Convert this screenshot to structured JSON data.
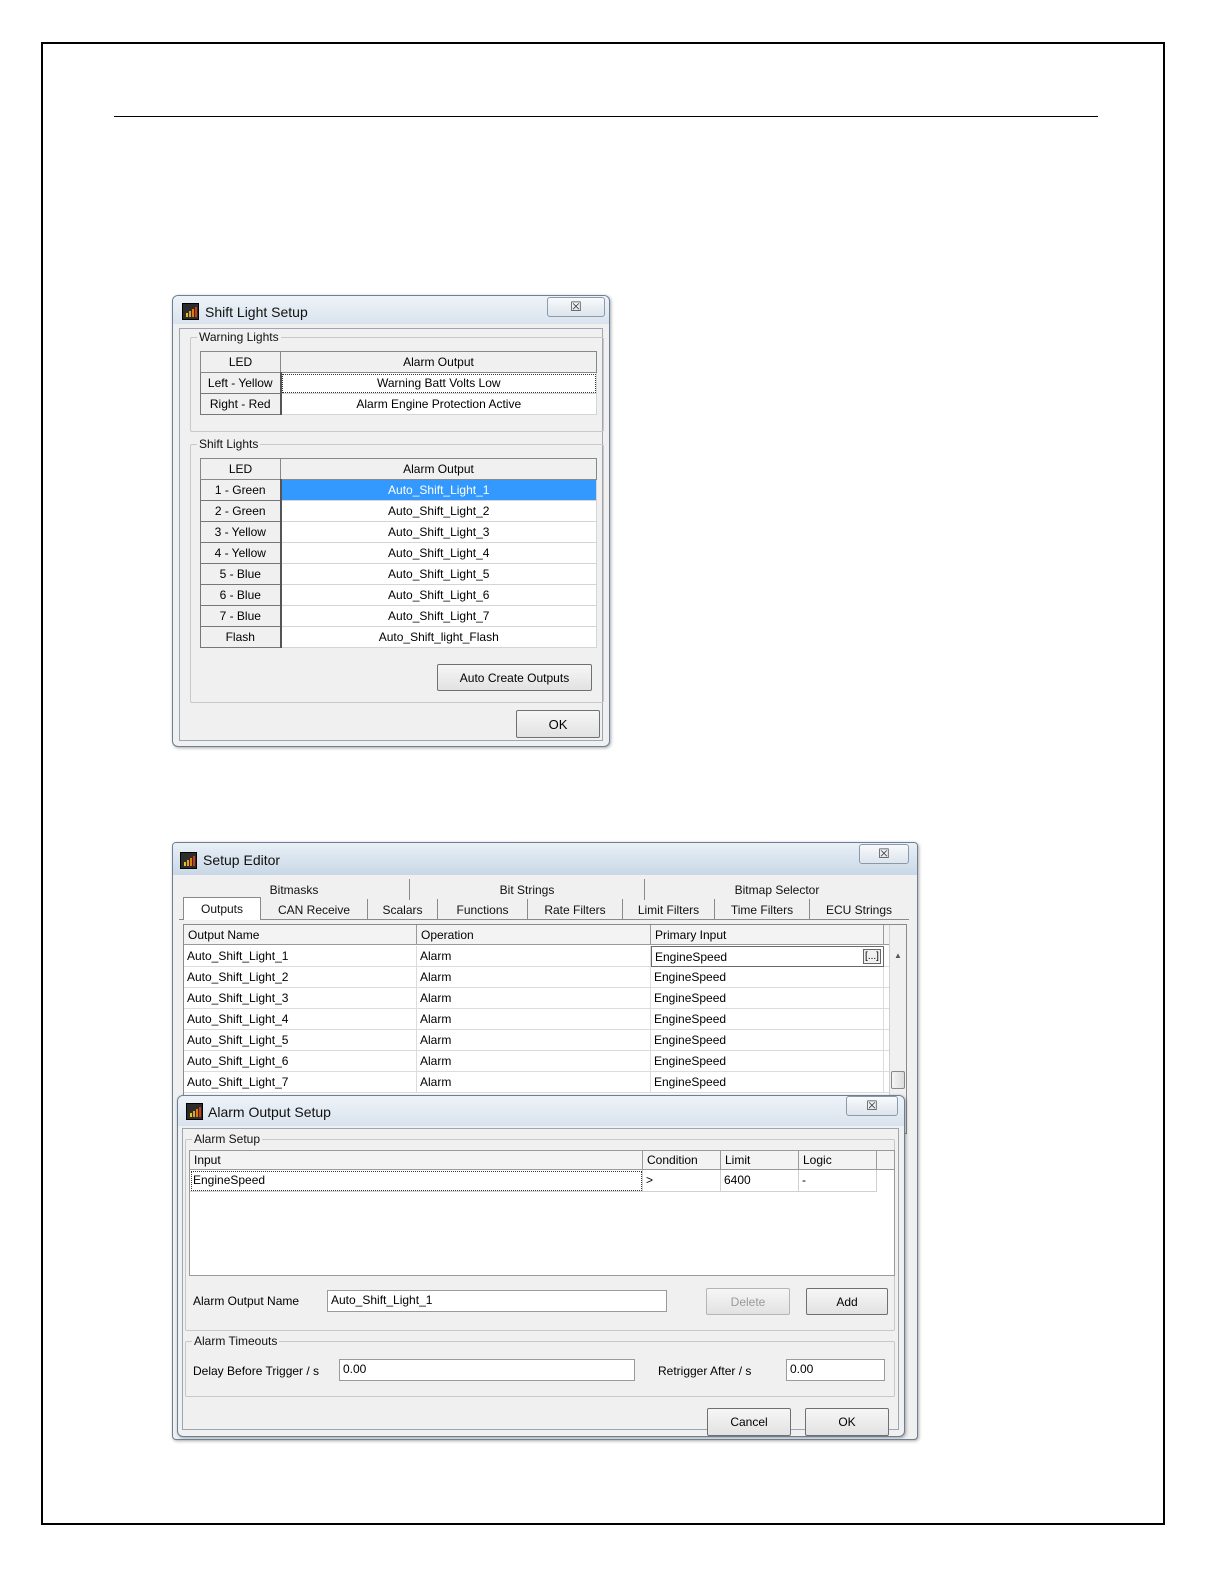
{
  "shift_light_dialog": {
    "title": "Shift Light Setup",
    "close_label": "☒",
    "warning_group": {
      "legend": "Warning Lights",
      "col_led": "LED",
      "col_output": "Alarm Output",
      "rows": [
        {
          "led": "Left - Yellow",
          "output": "Warning Batt Volts Low"
        },
        {
          "led": "Right - Red",
          "output": "Alarm Engine Protection Active"
        }
      ]
    },
    "shift_group": {
      "legend": "Shift Lights",
      "col_led": "LED",
      "col_output": "Alarm Output",
      "rows": [
        {
          "led": "1 - Green",
          "output": "Auto_Shift_Light_1"
        },
        {
          "led": "2 - Green",
          "output": "Auto_Shift_Light_2"
        },
        {
          "led": "3 - Yellow",
          "output": "Auto_Shift_Light_3"
        },
        {
          "led": "4 - Yellow",
          "output": "Auto_Shift_Light_4"
        },
        {
          "led": "5 - Blue",
          "output": "Auto_Shift_Light_5"
        },
        {
          "led": "6 - Blue",
          "output": "Auto_Shift_Light_6"
        },
        {
          "led": "7 - Blue",
          "output": "Auto_Shift_Light_7"
        },
        {
          "led": "Flash",
          "output": "Auto_Shift_light_Flash"
        }
      ],
      "selected_row": 0,
      "auto_create_label": "Auto Create Outputs"
    },
    "ok_label": "OK"
  },
  "setup_editor": {
    "title": "Setup Editor",
    "close_label": "☒",
    "tabs_row1": [
      "Bitmasks",
      "Bit Strings",
      "Bitmap Selector"
    ],
    "tabs_row2": [
      "Outputs",
      "CAN Receive",
      "Scalars",
      "Functions",
      "Rate Filters",
      "Limit Filters",
      "Time Filters",
      "ECU Strings"
    ],
    "active_tab": "Outputs",
    "columns": [
      "Output Name",
      "Operation",
      "Primary Input"
    ],
    "rows": [
      {
        "name": "Auto_Shift_Light_1",
        "operation": "Alarm",
        "input": "EngineSpeed"
      },
      {
        "name": "Auto_Shift_Light_2",
        "operation": "Alarm",
        "input": "EngineSpeed"
      },
      {
        "name": "Auto_Shift_Light_3",
        "operation": "Alarm",
        "input": "EngineSpeed"
      },
      {
        "name": "Auto_Shift_Light_4",
        "operation": "Alarm",
        "input": "EngineSpeed"
      },
      {
        "name": "Auto_Shift_Light_5",
        "operation": "Alarm",
        "input": "EngineSpeed"
      },
      {
        "name": "Auto_Shift_Light_6",
        "operation": "Alarm",
        "input": "EngineSpeed"
      },
      {
        "name": "Auto_Shift_Light_7",
        "operation": "Alarm",
        "input": "EngineSpeed"
      }
    ],
    "ellipsis_label": "[...]",
    "scroll_up_icon": "▲"
  },
  "alarm_output_dialog": {
    "title": "Alarm Output Setup",
    "close_label": "☒",
    "alarm_setup_legend": "Alarm Setup",
    "columns": [
      "Input",
      "Condition",
      "Limit",
      "Logic"
    ],
    "row": {
      "input": "EngineSpeed",
      "condition": ">",
      "limit": "6400",
      "logic": "-"
    },
    "name_label": "Alarm Output Name",
    "name_value": "Auto_Shift_Light_1",
    "delete_label": "Delete",
    "add_label": "Add",
    "timeouts_legend": "Alarm Timeouts",
    "delay_label": "Delay Before Trigger / s",
    "delay_value": "0.00",
    "retrigger_label": "Retrigger After / s",
    "retrigger_value": "0.00",
    "cancel_label": "Cancel",
    "ok_label": "OK"
  },
  "colors": {
    "selection": "#3399ff",
    "window_bg": "#f0f0f0",
    "titlebar": "#dbe5f0"
  }
}
